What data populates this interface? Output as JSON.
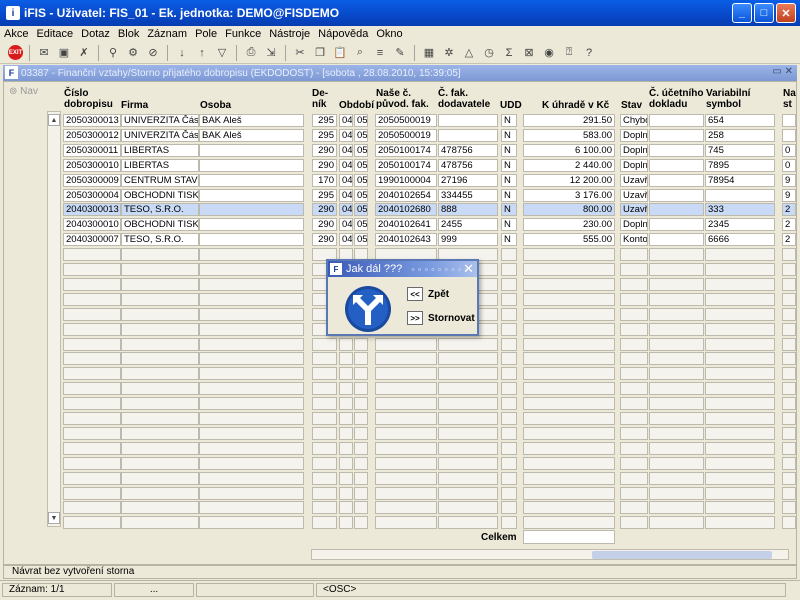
{
  "window": {
    "title": "iFIS - Uživatel: FIS_01 - Ek. jednotka: DEMO@FISDEMO",
    "app_icon": "i"
  },
  "menu": [
    "Akce",
    "Editace",
    "Dotaz",
    "Blok",
    "Záznam",
    "Pole",
    "Funkce",
    "Nástroje",
    "Nápověda",
    "Okno"
  ],
  "form": {
    "title": "03387 - Finanční vztahy/Storno přijatého dobropisu (EKDODOST) - [sobota , 28.08.2010, 15:39:05]",
    "nav_label": "Nav",
    "headers": {
      "cislo": [
        "Číslo",
        "dobropisu"
      ],
      "firma": "Firma",
      "osoba": "Osoba",
      "denik": [
        "De-",
        "ník"
      ],
      "obdobi": "Období",
      "nase": [
        "Naše č.",
        "původ. fak."
      ],
      "cfak": [
        "Č. fak.",
        "dodavatele"
      ],
      "udd": "UDD",
      "kuhrade": "K úhradě v Kč",
      "stav": "Stav",
      "cucet": [
        "Č. účetního",
        "dokladu"
      ],
      "varsym": [
        "Variabilní",
        "symbol"
      ],
      "na": [
        "Na",
        "st"
      ]
    },
    "rows": [
      {
        "cislo": "2050300013",
        "firma": "UNIVERZITA Část: E",
        "osoba": "BAK Aleš",
        "denik": "295",
        "obd1": "04",
        "obd2": "05",
        "nase": "2050500019",
        "cfak": "",
        "udd": "N",
        "kuhrade": "291.50",
        "stav": "Chybo",
        "cucet": "",
        "varsym": "654",
        "na": ""
      },
      {
        "cislo": "2050300012",
        "firma": "UNIVERZITA Část: E",
        "osoba": "BAK Aleš",
        "denik": "295",
        "obd1": "04",
        "obd2": "05",
        "nase": "2050500019",
        "cfak": "",
        "udd": "N",
        "kuhrade": "583.00",
        "stav": "Doplně",
        "cucet": "",
        "varsym": "258",
        "na": ""
      },
      {
        "cislo": "2050300011",
        "firma": "LIBERTAS",
        "osoba": "",
        "denik": "290",
        "obd1": "04",
        "obd2": "05",
        "nase": "2050100174",
        "cfak": "478756",
        "udd": "N",
        "kuhrade": "6 100.00",
        "stav": "Doplně",
        "cucet": "",
        "varsym": "745",
        "na": "0"
      },
      {
        "cislo": "2050300010",
        "firma": "LIBERTAS",
        "osoba": "",
        "denik": "290",
        "obd1": "04",
        "obd2": "05",
        "nase": "2050100174",
        "cfak": "478756",
        "udd": "N",
        "kuhrade": "2 440.00",
        "stav": "Doplně",
        "cucet": "",
        "varsym": "7895",
        "na": "0"
      },
      {
        "cislo": "2050300009",
        "firma": "CENTRUM STAVEBI",
        "osoba": "",
        "denik": "170",
        "obd1": "04",
        "obd2": "05",
        "nase": "1990100004",
        "cfak": "27196",
        "udd": "N",
        "kuhrade": "12 200.00",
        "stav": "Uzavře",
        "cucet": "",
        "varsym": "78954",
        "na": "9"
      },
      {
        "cislo": "2050300004",
        "firma": "OBCHODNI TISKARI",
        "osoba": "",
        "denik": "295",
        "obd1": "04",
        "obd2": "05",
        "nase": "2040102654",
        "cfak": "334455",
        "udd": "N",
        "kuhrade": "3 176.00",
        "stav": "Uzavře",
        "cucet": "",
        "varsym": "",
        "na": "9"
      },
      {
        "cislo": "2040300013",
        "firma": "TESO, S.R.O.",
        "osoba": "",
        "denik": "290",
        "obd1": "04",
        "obd2": "05",
        "nase": "2040102680",
        "cfak": "888",
        "udd": "N",
        "kuhrade": "800.00",
        "stav": "Uzavře",
        "cucet": "",
        "varsym": "333",
        "na": "2"
      },
      {
        "cislo": "2040300010",
        "firma": "OBCHODNI TISKARI",
        "osoba": "",
        "denik": "290",
        "obd1": "04",
        "obd2": "05",
        "nase": "2040102641",
        "cfak": "2455",
        "udd": "N",
        "kuhrade": "230.00",
        "stav": "Doplně",
        "cucet": "",
        "varsym": "2345",
        "na": "2"
      },
      {
        "cislo": "2040300007",
        "firma": "TESO, S.R.O.",
        "osoba": "",
        "denik": "290",
        "obd1": "04",
        "obd2": "05",
        "nase": "2040102643",
        "cfak": "999",
        "udd": "N",
        "kuhrade": "555.00",
        "stav": "Kontov",
        "cucet": "",
        "varsym": "6666",
        "na": "2"
      }
    ],
    "total_label": "Celkem"
  },
  "dialog": {
    "title": "Jak dál ???",
    "back_icon": "<<",
    "back_label": "Zpět",
    "cancel_icon": ">>",
    "cancel_label": "Stornovat"
  },
  "status": {
    "message": "Návrat bez vytvoření storna",
    "record": "Záznam: 1/1",
    "dots": "...",
    "mode": "<OSC>"
  }
}
